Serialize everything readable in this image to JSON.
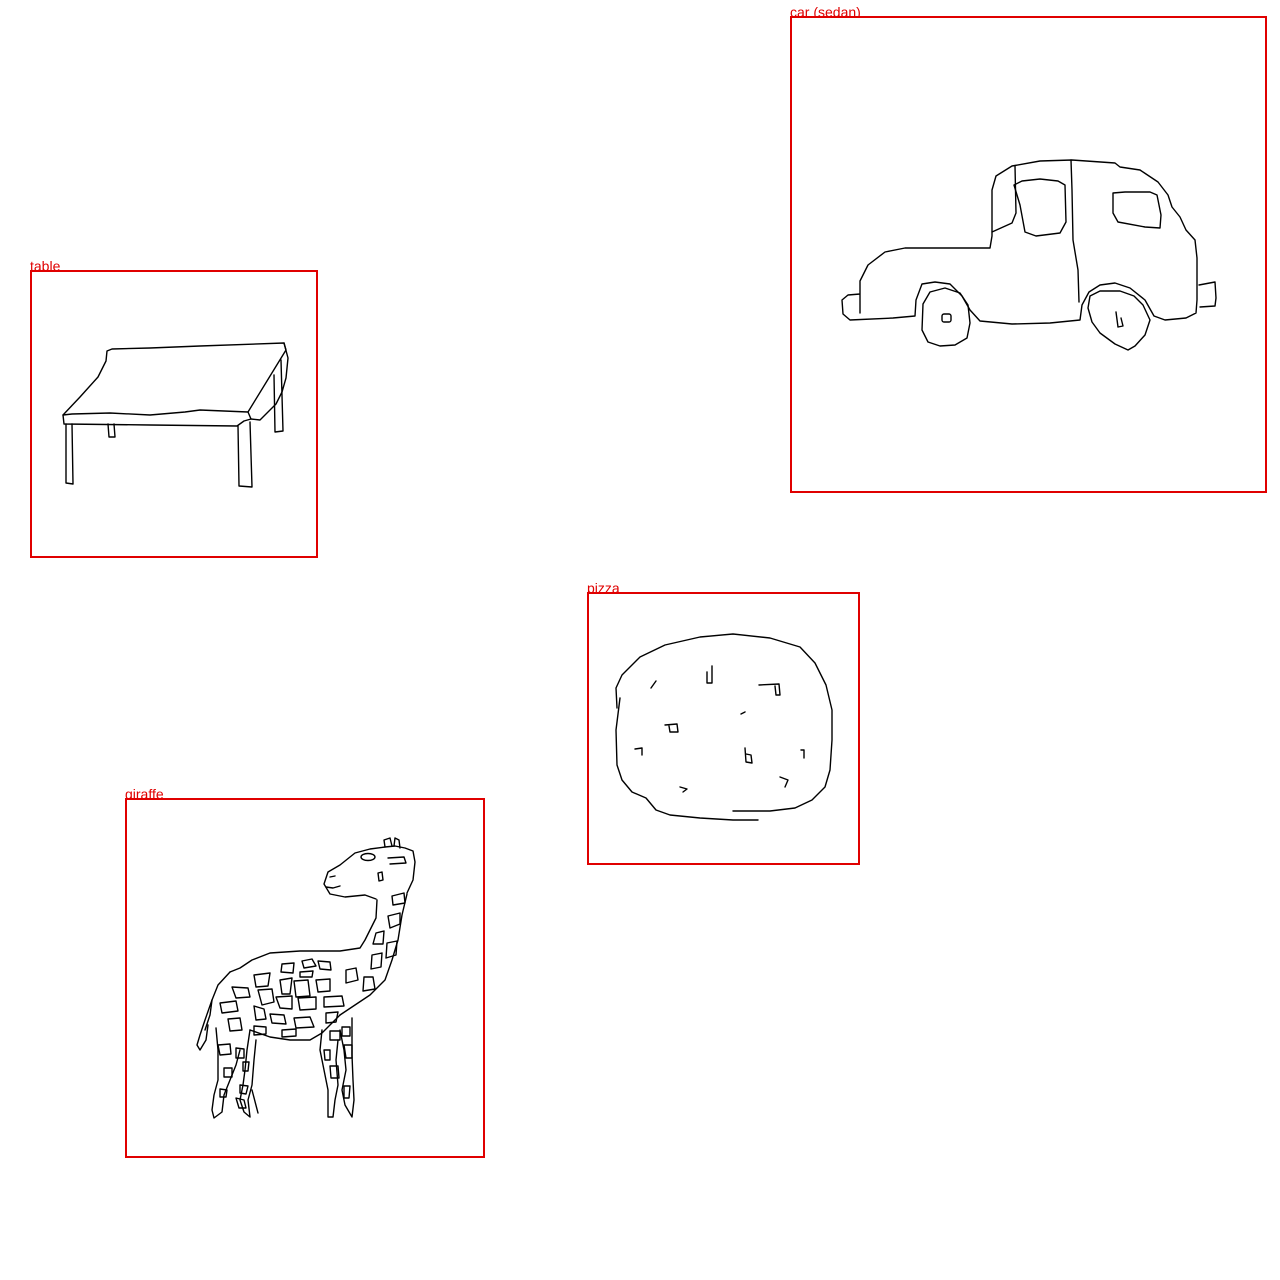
{
  "annotations": [
    {
      "id": "table",
      "label": "table"
    },
    {
      "id": "car",
      "label": "car (sedan)"
    },
    {
      "id": "pizza",
      "label": "pizza"
    },
    {
      "id": "giraffe",
      "label": "giraffe"
    }
  ],
  "colors": {
    "box_border": "#e00000",
    "label_text": "#e00000",
    "sketch_stroke": "#000000",
    "background": "#ffffff"
  }
}
